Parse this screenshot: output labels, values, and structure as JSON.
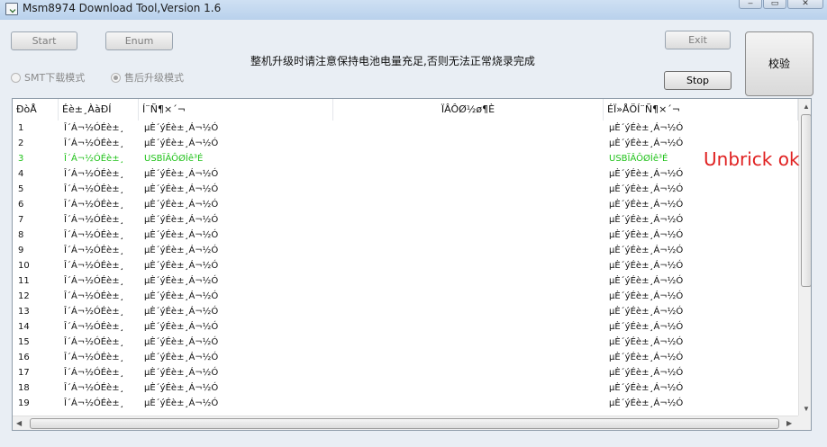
{
  "window": {
    "title": "Msm8974 Download Tool,Version 1.6",
    "controls": [
      "‒",
      "▭",
      "✕"
    ]
  },
  "toolbar": {
    "start_label": "Start",
    "enum_label": "Enum",
    "exit_label": "Exit",
    "stop_label": "Stop",
    "verify_label": "校验",
    "notice": "整机升级时请注意保持电池电量充足,否则无法正常烧录完成"
  },
  "modes": {
    "smt_label": "SMT下载模式",
    "aftersale_label": "售后升级模式",
    "selected": "aftersale"
  },
  "table": {
    "columns": [
      "ÐòÅ",
      "Éè±¸ÀàÐÍ",
      "Í¨Ñ¶×´¬",
      "ÏÂÔØ½ø¶È",
      "ÉÏ»ÅÖÍ¨Ñ¶×´¬"
    ],
    "rows": [
      {
        "no": "1",
        "type": "Î´Á¬½ÓÉè±¸",
        "comm": "µÈ´ýÉè±¸Á¬½Ó",
        "progress": "",
        "status": "µÈ´ýÉè±¸Á¬½Ó"
      },
      {
        "no": "2",
        "type": "Î´Á¬½ÓÉè±¸",
        "comm": "µÈ´ýÉè±¸Á¬½Ó",
        "progress": "",
        "status": "µÈ´ýÉè±¸Á¬½Ó"
      },
      {
        "no": "3",
        "type": "Î´Á¬½ÓÉè±¸",
        "comm": "USBÏÂÔØÍê³É",
        "progress": "",
        "status": "USBÏÂÔØÍê³É",
        "ok": true
      },
      {
        "no": "4",
        "type": "Î´Á¬½ÓÉè±¸",
        "comm": "µÈ´ýÉè±¸Á¬½Ó",
        "progress": "",
        "status": "µÈ´ýÉè±¸Á¬½Ó"
      },
      {
        "no": "5",
        "type": "Î´Á¬½ÓÉè±¸",
        "comm": "µÈ´ýÉè±¸Á¬½Ó",
        "progress": "",
        "status": "µÈ´ýÉè±¸Á¬½Ó"
      },
      {
        "no": "6",
        "type": "Î´Á¬½ÓÉè±¸",
        "comm": "µÈ´ýÉè±¸Á¬½Ó",
        "progress": "",
        "status": "µÈ´ýÉè±¸Á¬½Ó"
      },
      {
        "no": "7",
        "type": "Î´Á¬½ÓÉè±¸",
        "comm": "µÈ´ýÉè±¸Á¬½Ó",
        "progress": "",
        "status": "µÈ´ýÉè±¸Á¬½Ó"
      },
      {
        "no": "8",
        "type": "Î´Á¬½ÓÉè±¸",
        "comm": "µÈ´ýÉè±¸Á¬½Ó",
        "progress": "",
        "status": "µÈ´ýÉè±¸Á¬½Ó"
      },
      {
        "no": "9",
        "type": "Î´Á¬½ÓÉè±¸",
        "comm": "µÈ´ýÉè±¸Á¬½Ó",
        "progress": "",
        "status": "µÈ´ýÉè±¸Á¬½Ó"
      },
      {
        "no": "10",
        "type": "Î´Á¬½ÓÉè±¸",
        "comm": "µÈ´ýÉè±¸Á¬½Ó",
        "progress": "",
        "status": "µÈ´ýÉè±¸Á¬½Ó"
      },
      {
        "no": "11",
        "type": "Î´Á¬½ÓÉè±¸",
        "comm": "µÈ´ýÉè±¸Á¬½Ó",
        "progress": "",
        "status": "µÈ´ýÉè±¸Á¬½Ó"
      },
      {
        "no": "12",
        "type": "Î´Á¬½ÓÉè±¸",
        "comm": "µÈ´ýÉè±¸Á¬½Ó",
        "progress": "",
        "status": "µÈ´ýÉè±¸Á¬½Ó"
      },
      {
        "no": "13",
        "type": "Î´Á¬½ÓÉè±¸",
        "comm": "µÈ´ýÉè±¸Á¬½Ó",
        "progress": "",
        "status": "µÈ´ýÉè±¸Á¬½Ó"
      },
      {
        "no": "14",
        "type": "Î´Á¬½ÓÉè±¸",
        "comm": "µÈ´ýÉè±¸Á¬½Ó",
        "progress": "",
        "status": "µÈ´ýÉè±¸Á¬½Ó"
      },
      {
        "no": "15",
        "type": "Î´Á¬½ÓÉè±¸",
        "comm": "µÈ´ýÉè±¸Á¬½Ó",
        "progress": "",
        "status": "µÈ´ýÉè±¸Á¬½Ó"
      },
      {
        "no": "16",
        "type": "Î´Á¬½ÓÉè±¸",
        "comm": "µÈ´ýÉè±¸Á¬½Ó",
        "progress": "",
        "status": "µÈ´ýÉè±¸Á¬½Ó"
      },
      {
        "no": "17",
        "type": "Î´Á¬½ÓÉè±¸",
        "comm": "µÈ´ýÉè±¸Á¬½Ó",
        "progress": "",
        "status": "µÈ´ýÉè±¸Á¬½Ó"
      },
      {
        "no": "18",
        "type": "Î´Á¬½ÓÉè±¸",
        "comm": "µÈ´ýÉè±¸Á¬½Ó",
        "progress": "",
        "status": "µÈ´ýÉè±¸Á¬½Ó"
      },
      {
        "no": "19",
        "type": "Î´Á¬½ÓÉè±¸",
        "comm": "µÈ´ýÉè±¸Á¬½Ó",
        "progress": "",
        "status": "µÈ´ýÉè±¸Á¬½Ó"
      }
    ]
  },
  "annotation": "Unbrick ok",
  "colors": {
    "ok_row": "#21c21b",
    "annotation": "#e02020"
  }
}
